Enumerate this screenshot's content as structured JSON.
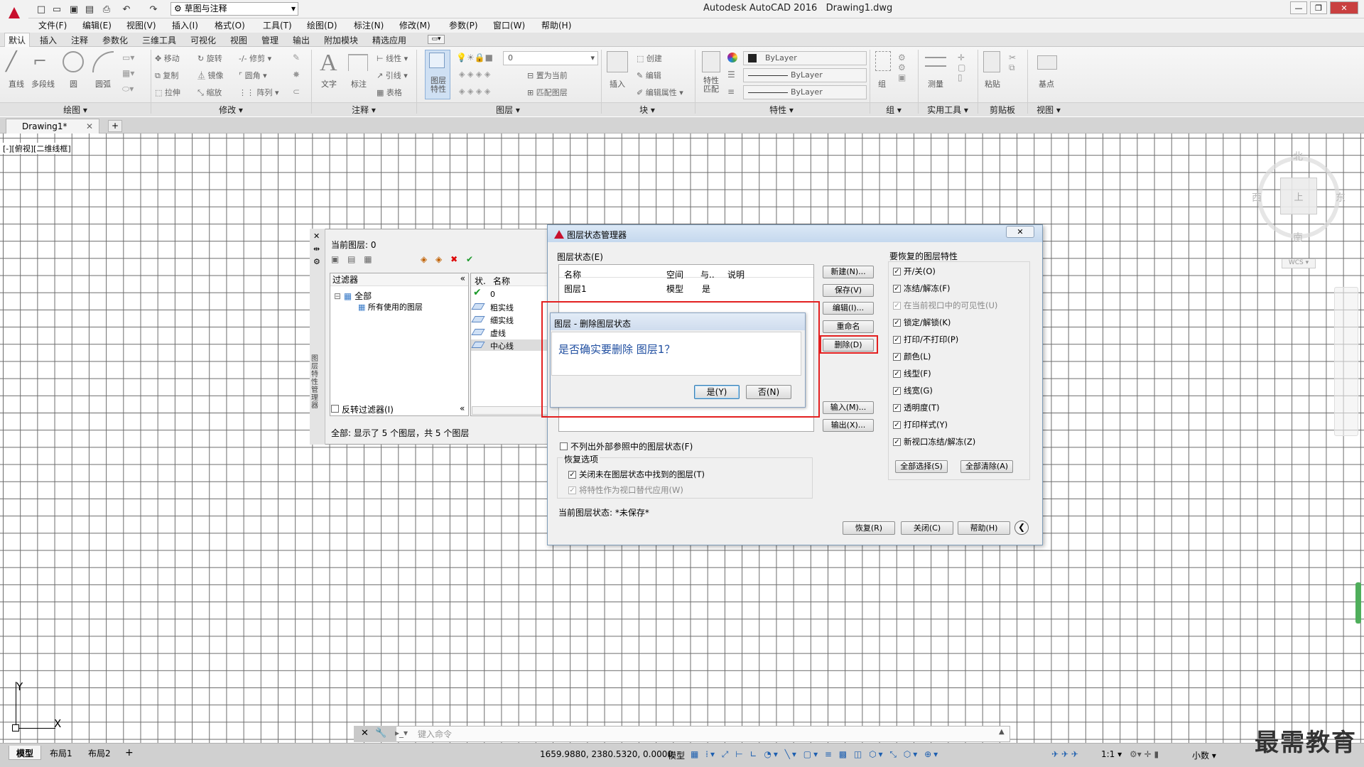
{
  "titlebar": {
    "app_title": "Autodesk AutoCAD 2016",
    "file_name": "Drawing1.dwg",
    "workspace": "草图与注释"
  },
  "menu": [
    "文件(F)",
    "编辑(E)",
    "视图(V)",
    "插入(I)",
    "格式(O)",
    "工具(T)",
    "绘图(D)",
    "标注(N)",
    "修改(M)",
    "参数(P)",
    "窗口(W)",
    "帮助(H)"
  ],
  "ribbon_tabs": [
    "默认",
    "插入",
    "注释",
    "参数化",
    "三维工具",
    "可视化",
    "视图",
    "管理",
    "输出",
    "附加模块",
    "精选应用"
  ],
  "ribbon": {
    "draw": {
      "title": "绘图",
      "tools": [
        "直线",
        "多段线",
        "圆",
        "圆弧"
      ]
    },
    "modify": {
      "title": "修改",
      "tools": [
        "移动",
        "旋转",
        "修剪",
        "复制",
        "镜像",
        "圆角",
        "拉伸",
        "缩放",
        "阵列"
      ]
    },
    "annotation": {
      "title": "注释",
      "tools": [
        "文字",
        "标注",
        "线性",
        "引线",
        "表格"
      ]
    },
    "layers": {
      "title": "图层",
      "big": "图层特性",
      "current_layer": "0",
      "tools": [
        "置为当前",
        "匹配图层"
      ]
    },
    "block": {
      "title": "块",
      "tools": [
        "插入",
        "创建",
        "编辑",
        "编辑属性"
      ]
    },
    "properties": {
      "title": "特性",
      "big": "特性匹配",
      "color": "ByLayer",
      "linetype": "ByLayer",
      "lineweight": "ByLayer"
    },
    "groups": {
      "title": "组",
      "big": "组"
    },
    "utilities": {
      "title": "实用工具",
      "big": "测量"
    },
    "clipboard": {
      "title": "剪贴板",
      "big": "粘贴"
    },
    "view": {
      "title": "视图",
      "big": "基点"
    }
  },
  "doc_tab": "Drawing1*",
  "viewport_label": "[-][俯视][二维线框]",
  "viewcube": {
    "north": "北",
    "south": "南",
    "east": "东",
    "west": "西",
    "top": "上",
    "wcs": "WCS"
  },
  "ucs": {
    "x": "X",
    "y": "Y"
  },
  "command_placeholder": "键入命令",
  "layout_tabs": [
    "模型",
    "布局1",
    "布局2"
  ],
  "status": {
    "coords": "1659.9880, 2380.5320, 0.0000",
    "mode": "模型",
    "scale": "1:1",
    "units": "小数"
  },
  "watermark": "最需教育",
  "layer_palette": {
    "title": "图层特性管理器",
    "current_layer": "当前图层: 0",
    "filters_header": "过滤器",
    "filter_tree": [
      "全部",
      "所有使用的图层"
    ],
    "list_header": [
      "状.",
      "名称"
    ],
    "layers": [
      "0",
      "粗实线",
      "细实线",
      "虚线",
      "中心线"
    ],
    "invert_filter": "反转过滤器(I)",
    "footer": "全部: 显示了 5 个图层，共 5 个图层"
  },
  "layer_state_manager": {
    "title": "图层状态管理器",
    "states_label": "图层状态(E)",
    "columns": [
      "名称",
      "空间",
      "与..",
      "说明"
    ],
    "rows": [
      {
        "name": "图层1",
        "space": "模型",
        "same": "是",
        "desc": ""
      }
    ],
    "buttons": [
      "新建(N)...",
      "保存(V)",
      "编辑(I)...",
      "重命名",
      "删除(D)",
      "输入(M)...",
      "输出(X)..."
    ],
    "restore_props_title": "要恢复的图层特性",
    "restore_props": [
      {
        "label": "开/关(O)",
        "checked": true,
        "disabled": false
      },
      {
        "label": "冻结/解冻(F)",
        "checked": true,
        "disabled": false
      },
      {
        "label": "在当前视口中的可见性(U)",
        "checked": true,
        "disabled": true
      },
      {
        "label": "锁定/解锁(K)",
        "checked": true,
        "disabled": false
      },
      {
        "label": "打印/不打印(P)",
        "checked": true,
        "disabled": false
      },
      {
        "label": "颜色(L)",
        "checked": true,
        "disabled": false
      },
      {
        "label": "线型(F)",
        "checked": true,
        "disabled": false
      },
      {
        "label": "线宽(G)",
        "checked": true,
        "disabled": false
      },
      {
        "label": "透明度(T)",
        "checked": true,
        "disabled": false
      },
      {
        "label": "打印样式(Y)",
        "checked": true,
        "disabled": false
      },
      {
        "label": "新视口冻结/解冻(Z)",
        "checked": true,
        "disabled": false
      }
    ],
    "select_all": "全部选择(S)",
    "clear_all": "全部清除(A)",
    "no_xref": "不列出外部参照中的图层状态(F)",
    "restore_options": "恢复选项",
    "restore_opt1": "关闭未在图层状态中找到的图层(T)",
    "restore_opt2": "将特性作为视口替代应用(W)",
    "current_state": "当前图层状态: *未保存*",
    "restore": "恢复(R)",
    "close": "关闭(C)",
    "help": "帮助(H)"
  },
  "confirm_dialog": {
    "title": "图层 - 删除图层状态",
    "message": "是否确实要删除 图层1？",
    "yes": "是(Y)",
    "no": "否(N)"
  },
  "colors": {
    "accent_red": "#e32020",
    "autocad_red": "#c8102e",
    "message_blue": "#1f4ea0"
  }
}
